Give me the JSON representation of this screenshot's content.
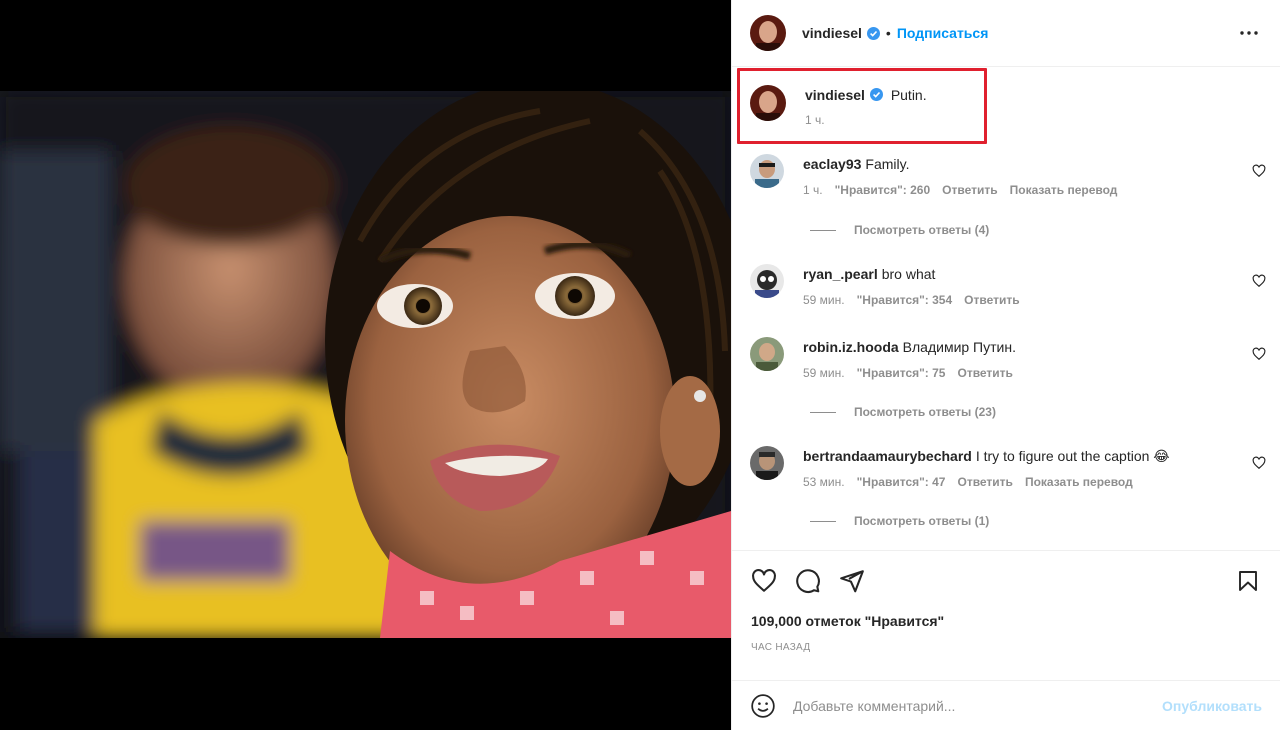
{
  "post": {
    "author": "vindiesel",
    "follow_label": "Подписаться",
    "dot": "•",
    "more_icon": "more-horizontal-icon"
  },
  "caption": {
    "author": "vindiesel",
    "text": "Putin.",
    "time": "1 ч."
  },
  "comments": [
    {
      "user": "eaclay93",
      "text": "Family.",
      "time": "1 ч.",
      "likes": "\"Нравится\": 260",
      "reply": "Ответить",
      "translate": "Показать перевод",
      "view_replies": "Посмотреть ответы (4)"
    },
    {
      "user": "ryan_.pearl",
      "text": "bro what",
      "time": "59 мин.",
      "likes": "\"Нравится\": 354",
      "reply": "Ответить"
    },
    {
      "user": "robin.iz.hooda",
      "text": "Владимир Путин.",
      "time": "59 мин.",
      "likes": "\"Нравится\": 75",
      "reply": "Ответить",
      "view_replies": "Посмотреть ответы (23)"
    },
    {
      "user": "bertrandaamaurybechard",
      "text": "I try to figure out the caption 😂",
      "time": "53 мин.",
      "likes": "\"Нравится\": 47",
      "reply": "Ответить",
      "translate": "Показать перевод",
      "view_replies": "Посмотреть ответы (1)"
    }
  ],
  "actions": {
    "likes_count": "109,000 отметок \"Нравится\"",
    "posted_ago": "ЧАС НАЗАД"
  },
  "add_comment": {
    "placeholder": "Добавьте комментарий...",
    "post_label": "Опубликовать"
  },
  "colors": {
    "link_blue": "#0095f6",
    "verified_blue": "#3897f0",
    "highlight_red": "#e0202e",
    "muted_gray": "#8e8e8e"
  }
}
